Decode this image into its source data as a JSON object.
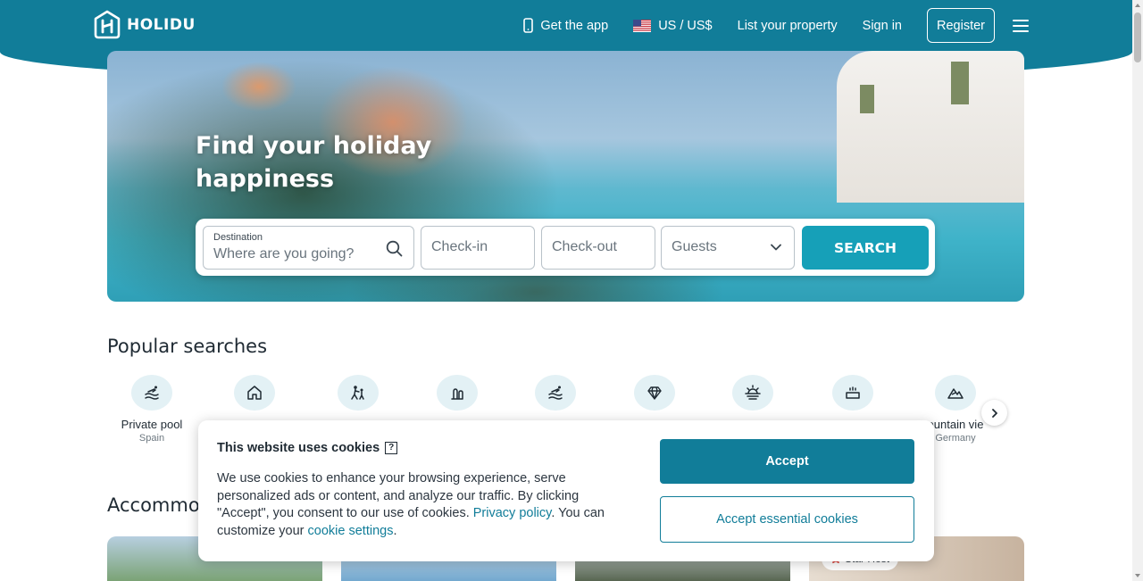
{
  "header": {
    "brand": "HOLIDU",
    "get_app": "Get the app",
    "currency": "US / US$",
    "list_property": "List your property",
    "sign_in": "Sign in",
    "register": "Register",
    "icons": [
      "phone-icon",
      "us-flag-icon",
      "menu-icon"
    ]
  },
  "hero": {
    "title": "Find your holiday happiness",
    "search": {
      "destination_label": "Destination",
      "destination_placeholder": "Where are you going?",
      "checkin": "Check-in",
      "checkout": "Check-out",
      "guests": "Guests",
      "button": "SEARCH"
    }
  },
  "popular": {
    "title": "Popular searches",
    "items": [
      {
        "label": "Private pool",
        "sub": "Spain",
        "icon": "pool-icon"
      },
      {
        "label": "",
        "sub": "",
        "icon": "house-icon"
      },
      {
        "label": "",
        "sub": "",
        "icon": "child-friendly-icon"
      },
      {
        "label": "",
        "sub": "",
        "icon": "island-icon"
      },
      {
        "label": "",
        "sub": "",
        "icon": "beach-pool-icon"
      },
      {
        "label": "",
        "sub": "",
        "icon": "diamond-icon"
      },
      {
        "label": "",
        "sub": "",
        "icon": "sunset-icon"
      },
      {
        "label": "",
        "sub": "",
        "icon": "hot-tub-icon"
      },
      {
        "label": "ountain vie",
        "sub": "Germany",
        "icon": "mountain-icon"
      }
    ]
  },
  "accommodations": {
    "title": "Accommo",
    "card_badge": "Star Host"
  },
  "cookie": {
    "title": "This website uses cookies",
    "text_1": "We use cookies to enhance your browsing experience, serve personalized ads or content, and analyze our traffic. By clicking \"Accept\", you consent to our use of cookies. ",
    "privacy_link": "Privacy policy",
    "text_2": ". You can customize your ",
    "settings_link": "cookie settings",
    "text_3": ".",
    "accept": "Accept",
    "accept_essential": "Accept essential cookies"
  },
  "colors": {
    "brand": "#117d99",
    "search_button": "#16a0b8",
    "icon_bg": "#e3f1f5"
  }
}
